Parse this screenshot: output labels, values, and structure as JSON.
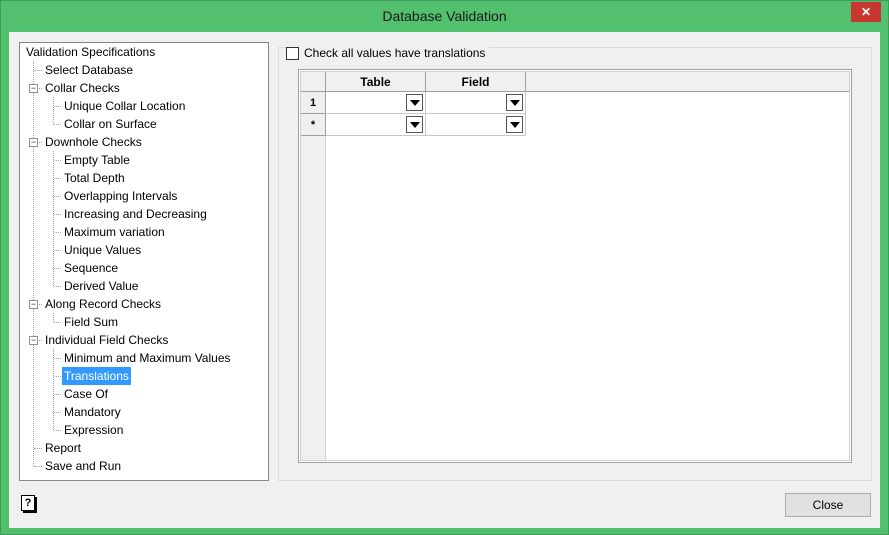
{
  "window": {
    "title": "Database Validation",
    "close_glyph": "✕"
  },
  "tree": {
    "root": "Validation Specifications",
    "items": [
      {
        "label": "Select Database"
      },
      {
        "label": "Collar Checks",
        "expanded": true
      },
      {
        "label": "Unique Collar Location"
      },
      {
        "label": "Collar on Surface"
      },
      {
        "label": "Downhole Checks",
        "expanded": true
      },
      {
        "label": "Empty Table"
      },
      {
        "label": "Total Depth"
      },
      {
        "label": "Overlapping Intervals"
      },
      {
        "label": "Increasing and Decreasing"
      },
      {
        "label": "Maximum variation"
      },
      {
        "label": "Unique Values"
      },
      {
        "label": "Sequence"
      },
      {
        "label": "Derived Value"
      },
      {
        "label": "Along Record Checks",
        "expanded": true
      },
      {
        "label": "Field Sum"
      },
      {
        "label": "Individual Field Checks",
        "expanded": true
      },
      {
        "label": "Minimum and Maximum Values"
      },
      {
        "label": "Translations",
        "selected": true
      },
      {
        "label": "Case Of"
      },
      {
        "label": "Mandatory"
      },
      {
        "label": "Expression"
      },
      {
        "label": "Report"
      },
      {
        "label": "Save and Run"
      }
    ],
    "toggle_glyph": "−"
  },
  "panel": {
    "checkbox_label": "Check all values have translations",
    "checkbox_checked": false,
    "grid": {
      "columns": [
        "Table",
        "Field"
      ],
      "rows": [
        {
          "header": "1",
          "table": "",
          "field": ""
        },
        {
          "header": "*",
          "table": "",
          "field": ""
        }
      ]
    }
  },
  "footer": {
    "help_glyph": "?",
    "close_label": "Close"
  },
  "colors": {
    "titlebar": "#53c06e",
    "selection": "#3399ff",
    "close_x": "#c7372f"
  }
}
